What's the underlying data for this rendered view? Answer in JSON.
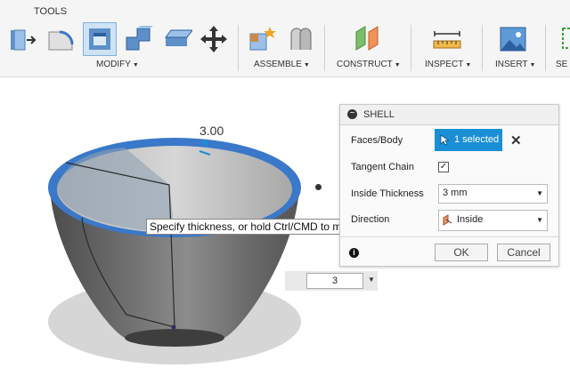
{
  "toolbar": {
    "tab": "TOOLS",
    "groups": {
      "modify": "MODIFY",
      "assemble": "ASSEMBLE",
      "construct": "CONSTRUCT",
      "inspect": "INSPECT",
      "insert": "INSERT",
      "select": "SE"
    },
    "icons": [
      "press-pull-icon",
      "fillet-icon",
      "shell-icon",
      "combine-icon",
      "replace-face-icon",
      "move-icon",
      "new-component-icon",
      "joint-icon",
      "offset-plane-icon",
      "measure-icon",
      "insert-image-icon",
      "select-icon"
    ]
  },
  "viewport": {
    "dimension_label": "3.00",
    "tooltip": "Specify thickness, or hold Ctrl/CMD to modify selections",
    "thickness_input": "3"
  },
  "dialog": {
    "title": "SHELL",
    "faces_label": "Faces/Body",
    "faces_button": "1 selected",
    "tangent_label": "Tangent Chain",
    "tangent_checked": "✓",
    "thickness_label": "Inside Thickness",
    "thickness_value": "3 mm",
    "direction_label": "Direction",
    "direction_value": "Inside",
    "ok": "OK",
    "cancel": "Cancel"
  },
  "colors": {
    "accent": "#1a8fd6",
    "selection": "#3a78c9"
  }
}
